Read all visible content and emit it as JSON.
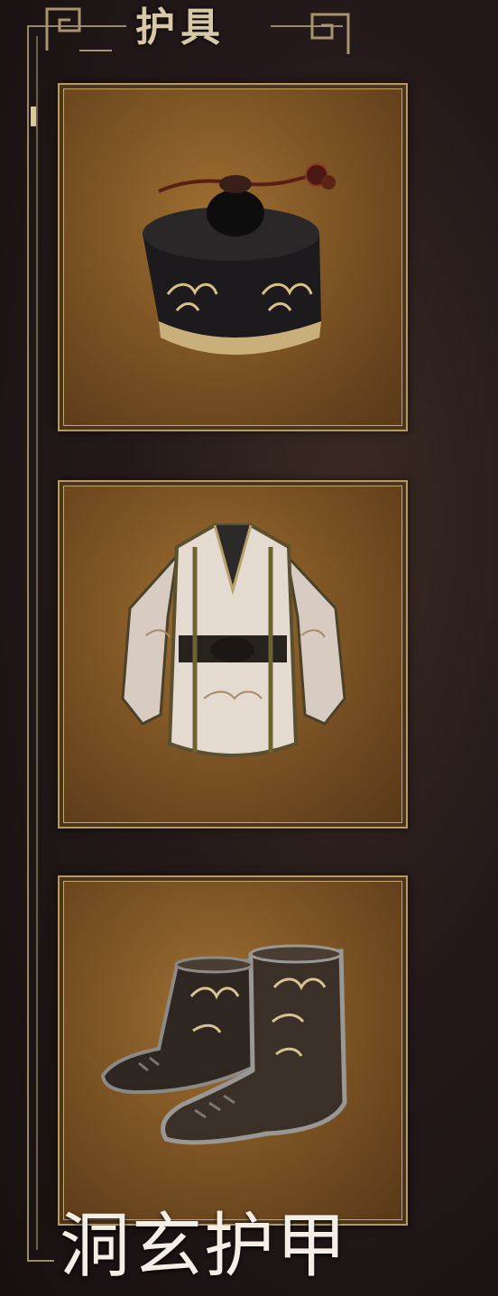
{
  "panel": {
    "title": "护具",
    "caption": "洞玄护甲",
    "slots": [
      {
        "item": "hat-icon"
      },
      {
        "item": "robe-icon"
      },
      {
        "item": "boots-icon"
      }
    ]
  },
  "colors": {
    "frame_gold": "#b89a5c",
    "card_bg": "#7d5424",
    "title_text": "#d8c9a6",
    "caption_text": "#f4efe6"
  }
}
